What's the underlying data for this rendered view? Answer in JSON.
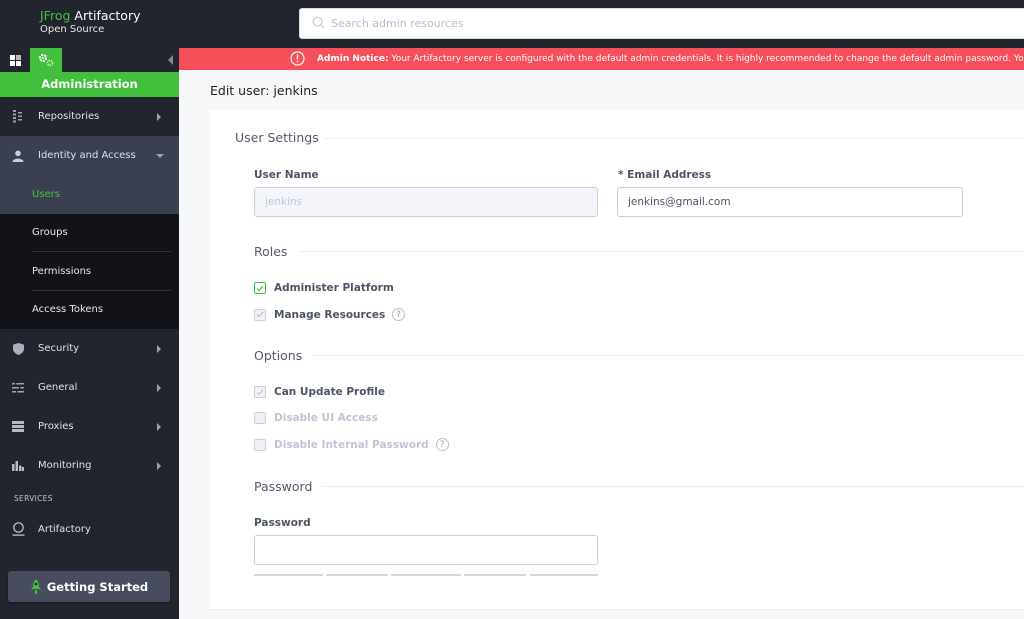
{
  "topbar": {
    "brand_prefix": "JFrog",
    "brand_name": " Artifactory",
    "edition": "Open Source",
    "search_placeholder": "Search admin resources",
    "search_value": ""
  },
  "sidebar": {
    "title": "Administration",
    "items": [
      {
        "label": "Repositories",
        "icon": "repositories-icon",
        "expanded": false
      },
      {
        "label": "Identity and Access",
        "icon": "user-icon",
        "expanded": true,
        "children": [
          {
            "label": "Users",
            "active": true
          },
          {
            "label": "Groups",
            "active": false
          },
          {
            "label": "Permissions",
            "active": false
          },
          {
            "label": "Access Tokens",
            "active": false
          }
        ]
      },
      {
        "label": "Security",
        "icon": "shield-icon",
        "expanded": false
      },
      {
        "label": "General",
        "icon": "sliders-icon",
        "expanded": false
      },
      {
        "label": "Proxies",
        "icon": "server-icon",
        "expanded": false
      },
      {
        "label": "Monitoring",
        "icon": "bar-chart-icon",
        "expanded": false
      }
    ],
    "services_header": "SERVICES",
    "services": [
      {
        "label": "Artifactory",
        "icon": "artifactory-icon"
      }
    ],
    "getting_started": "Getting Started"
  },
  "notice": {
    "title": "Admin Notice:",
    "text": " Your Artifactory server is configured with the default admin credentials. It is highly recommended to change the default admin password. You can change it"
  },
  "page": {
    "title": "Edit user: jenkins"
  },
  "form": {
    "user_settings_header": "User Settings",
    "username_label": "User Name",
    "username_value": "jenkins",
    "email_label": "* Email Address",
    "email_value": "jenkins@gmail.com",
    "roles_header": "Roles",
    "roles": [
      {
        "label": "Administer Platform",
        "checked": true,
        "disabled": false,
        "help": false
      },
      {
        "label": "Manage Resources",
        "checked": true,
        "disabled": true,
        "help": true
      }
    ],
    "options_header": "Options",
    "options": [
      {
        "label": "Can Update Profile",
        "checked": true,
        "disabled": false,
        "help": false
      },
      {
        "label": "Disable UI Access",
        "checked": false,
        "disabled": true,
        "help": false
      },
      {
        "label": "Disable Internal Password",
        "checked": false,
        "disabled": true,
        "help": true
      }
    ],
    "password_header": "Password",
    "password_label": "Password",
    "password_value": "",
    "password_strength_segments": 5,
    "password_strength_filled": 0
  }
}
